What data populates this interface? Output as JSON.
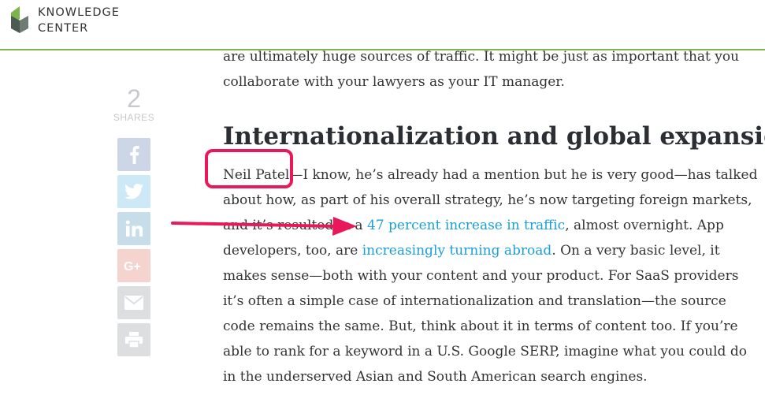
{
  "header": {
    "brand_line1": "KNOWLEDGE",
    "brand_line2": "CENTER",
    "accent_color": "#7db54a"
  },
  "share": {
    "count": "2",
    "label": "SHARES",
    "buttons": [
      {
        "name": "facebook",
        "icon": "facebook-icon",
        "color": "#cdd6e6"
      },
      {
        "name": "twitter",
        "icon": "twitter-icon",
        "color": "#cde8f6"
      },
      {
        "name": "linkedin",
        "icon": "linkedin-icon",
        "color": "#c7dde9"
      },
      {
        "name": "google-plus",
        "icon": "google-plus-icon",
        "color": "#f5d3cf"
      },
      {
        "name": "email",
        "icon": "email-icon",
        "color": "#dcdee0"
      },
      {
        "name": "print",
        "icon": "print-icon",
        "color": "#dcdee0"
      }
    ]
  },
  "article": {
    "intro_lines": [
      "are ultimately huge sources of traffic. It might be just as important that you",
      "collaborate with your lawyers as your IT manager."
    ],
    "heading": "Internationalization and global expansion",
    "body": {
      "line1_link": "Neil Patel",
      "line1_rest": "—I know, he’s already had a mention but he is very good—has talked",
      "line2": "about how, as part of his overall strategy, he’s now targeting foreign markets,",
      "line3_pre": "and it’s resulted in a ",
      "line3_link": "47 percent increase in traffic",
      "line3_post": ", almost overnight. App",
      "line4_pre": "developers, too, are ",
      "line4_link": "increasingly turning abroad",
      "line4_post": ". On a very basic level, it",
      "line5": "makes sense—both with your content and your product. For SaaS providers",
      "line6": "it’s often a simple case of internationalization and translation—the source",
      "line7": "code remains the same. But, think about it in terms of content too. If you’re",
      "line8": "able to rank for a keyword in a U.S. Google SERP, imagine what you could do",
      "line9": "in the underserved Asian and South American search engines."
    },
    "link_color": "#1a9fd9"
  },
  "annotations": {
    "highlight_color": "#e8185a"
  }
}
